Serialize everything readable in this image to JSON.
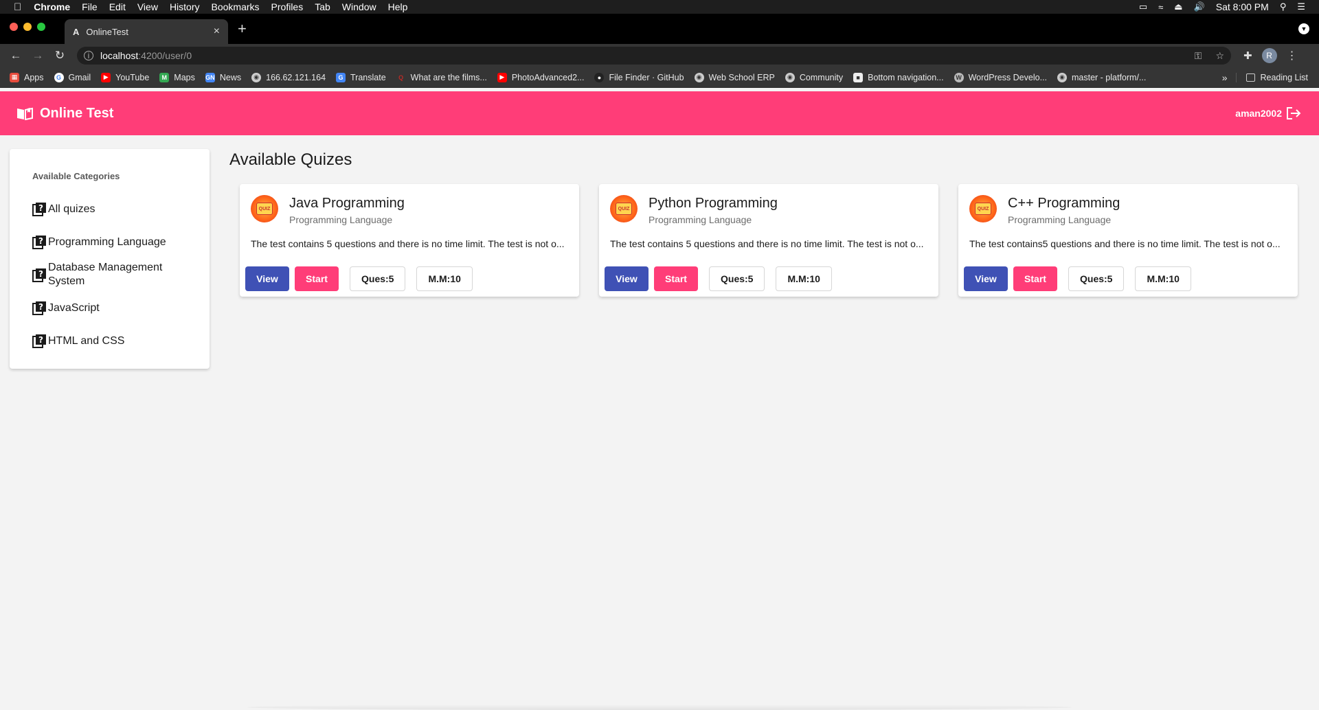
{
  "os_menu": {
    "app": "Chrome",
    "items": [
      "File",
      "Edit",
      "View",
      "History",
      "Bookmarks",
      "Profiles",
      "Tab",
      "Window",
      "Help"
    ],
    "clock": "Sat 8:00 PM"
  },
  "browser": {
    "tab_title": "OnlineTest",
    "url_host": "localhost",
    "url_path": ":4200/user/0",
    "profile_initial": "R",
    "bookmarks": [
      {
        "label": "Apps",
        "icon": "apps-grid-icon",
        "color": "#e84c3d"
      },
      {
        "label": "Gmail",
        "icon": "google-icon",
        "color": "#ffffff"
      },
      {
        "label": "YouTube",
        "icon": "youtube-icon",
        "color": "#ff0000"
      },
      {
        "label": "Maps",
        "icon": "maps-icon",
        "color": "#34a853"
      },
      {
        "label": "News",
        "icon": "news-icon",
        "color": "#4285f4"
      },
      {
        "label": "166.62.121.164",
        "icon": "globe-icon",
        "color": "#cccccc"
      },
      {
        "label": "Translate",
        "icon": "translate-icon",
        "color": "#4285f4"
      },
      {
        "label": "What are the films...",
        "icon": "quora-icon",
        "color": "#b92b27"
      },
      {
        "label": "PhotoAdvanced2...",
        "icon": "youtube-icon",
        "color": "#ff0000"
      },
      {
        "label": "File Finder · GitHub",
        "icon": "github-icon",
        "color": "#222222"
      },
      {
        "label": "Web School ERP",
        "icon": "globe-icon",
        "color": "#cccccc"
      },
      {
        "label": "Community",
        "icon": "globe-icon",
        "color": "#cccccc"
      },
      {
        "label": "Bottom navigation...",
        "icon": "doc-icon",
        "color": "#eeeeee"
      },
      {
        "label": "WordPress Develo...",
        "icon": "wordpress-icon",
        "color": "#bbbbbb"
      },
      {
        "label": "master - platform/...",
        "icon": "globe-icon",
        "color": "#cccccc"
      }
    ],
    "more": "»",
    "reading_list": "Reading List"
  },
  "app": {
    "title": "Online Test",
    "username": "aman2002",
    "brand_color": "#ff3d78",
    "primary_color": "#3f51b5"
  },
  "sidebar": {
    "heading": "Available Categories",
    "items": [
      {
        "label": "All quizes"
      },
      {
        "label": "Programming Language"
      },
      {
        "label": "Database Management System"
      },
      {
        "label": "JavaScript"
      },
      {
        "label": "HTML and CSS"
      }
    ]
  },
  "main": {
    "title": "Available Quizes",
    "quizzes": [
      {
        "title": "Java Programming",
        "category": "Programming Language",
        "description": "The test contains 5 questions and there is no time limit. The test is not o...",
        "view_label": "View",
        "start_label": "Start",
        "questions": "Ques:5",
        "max_marks": "M.M:10"
      },
      {
        "title": "Python Programming",
        "category": "Programming Language",
        "description": "The test contains 5 questions and there is no time limit. The test is not o...",
        "view_label": "View",
        "start_label": "Start",
        "questions": "Ques:5",
        "max_marks": "M.M:10"
      },
      {
        "title": "C++ Programming",
        "category": "Programming Language",
        "description": "The test contains5 questions and there is no time limit. The test is not o...",
        "view_label": "View",
        "start_label": "Start",
        "questions": "Ques:5",
        "max_marks": "M.M:10"
      }
    ]
  }
}
